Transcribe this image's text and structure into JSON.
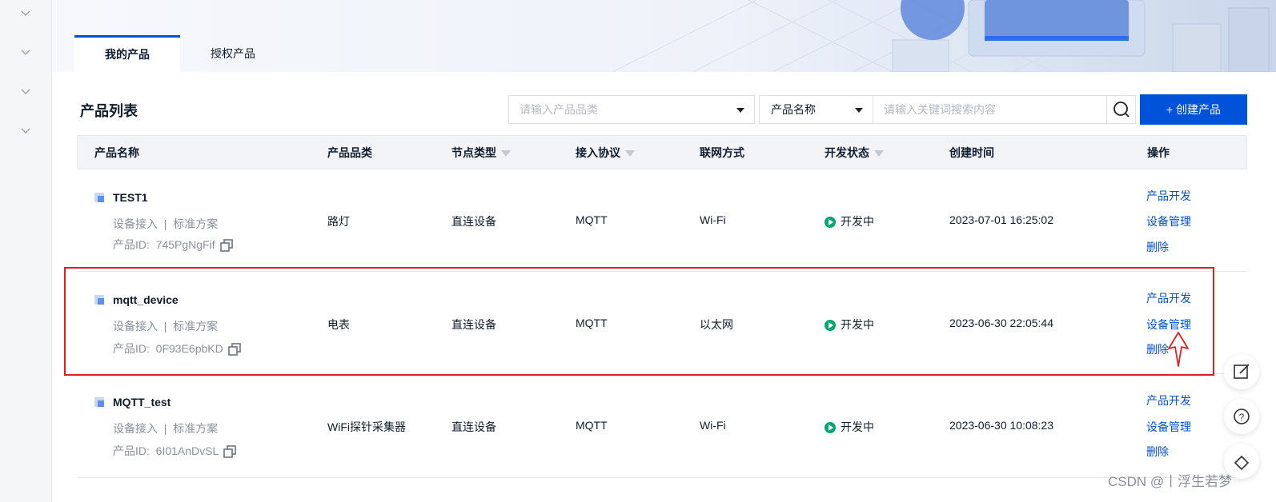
{
  "tabs": [
    {
      "label": "我的产品",
      "active": true
    },
    {
      "label": "授权产品",
      "active": false
    }
  ],
  "list_title": "产品列表",
  "filters": {
    "category_placeholder": "请输入产品品类",
    "field_select": "产品名称",
    "keyword_placeholder": "请输入关键词搜索内容"
  },
  "create_button": "+ 创建产品",
  "columns": [
    "产品名称",
    "产品品类",
    "节点类型",
    "接入协议",
    "联网方式",
    "开发状态",
    "创建时间",
    "操作"
  ],
  "rows": [
    {
      "name": "TEST1",
      "access": "设备接入",
      "sep": "|",
      "scheme": "标准方案",
      "pid_label": "产品ID:",
      "pid": "745PgNgFif",
      "category": "路灯",
      "node_type": "直连设备",
      "protocol": "MQTT",
      "network": "Wi-Fi",
      "status": "开发中",
      "created": "2023-07-01 16:25:02",
      "actions": [
        "产品开发",
        "设备管理",
        "删除"
      ]
    },
    {
      "name": "mqtt_device",
      "access": "设备接入",
      "sep": "|",
      "scheme": "标准方案",
      "pid_label": "产品ID:",
      "pid": "0F93E6pbKD",
      "category": "电表",
      "node_type": "直连设备",
      "protocol": "MQTT",
      "network": "以太网",
      "status": "开发中",
      "created": "2023-06-30 22:05:44",
      "actions": [
        "产品开发",
        "设备管理",
        "删除"
      ]
    },
    {
      "name": "MQTT_test",
      "access": "设备接入",
      "sep": "|",
      "scheme": "标准方案",
      "pid_label": "产品ID:",
      "pid": "6I01AnDvSL",
      "category": "WiFi探针采集器",
      "node_type": "直连设备",
      "protocol": "MQTT",
      "network": "Wi-Fi",
      "status": "开发中",
      "created": "2023-06-30 10:08:23",
      "actions": [
        "产品开发",
        "设备管理",
        "删除"
      ]
    }
  ],
  "watermark": "CSDN @丨浮生若梦",
  "colors": {
    "primary": "#0052d9",
    "success": "#00a870",
    "highlight": "#e02020"
  },
  "icons": {
    "search": "search-icon",
    "copy": "copy-icon",
    "edit": "edit-icon",
    "help": "help-icon",
    "status": "play-circle-icon"
  }
}
